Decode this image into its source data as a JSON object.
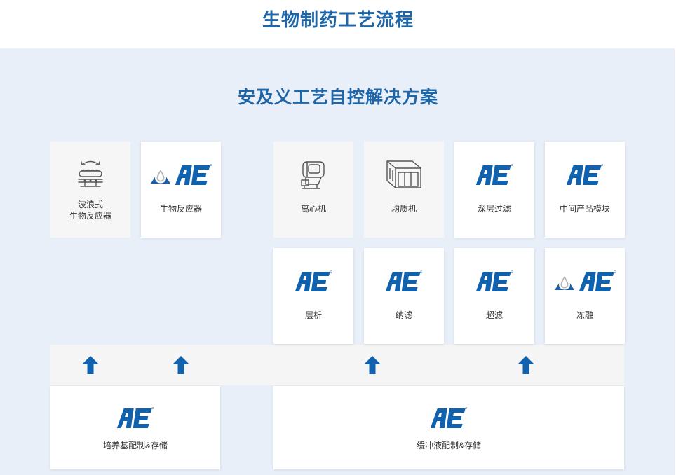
{
  "header": {
    "title": "生物制药工艺流程"
  },
  "panel": {
    "title": "安及义工艺自控解决方案"
  },
  "colors": {
    "brand_blue": "#1061ae",
    "title_blue": "#1f66a8",
    "drop_blue": "#1a5fa8"
  },
  "logo": {
    "text": "AE"
  },
  "cards": {
    "wave_bioreactor": {
      "label_line1": "波浪式",
      "label_line2": "生物反应器",
      "icon": "wave-bioreactor-icon"
    },
    "bioreactor": {
      "label": "生物反应器",
      "icon": "drop-ae-logo-icon"
    },
    "centrifuge": {
      "label": "离心机",
      "icon": "centrifuge-icon"
    },
    "homogenizer": {
      "label": "均质机",
      "icon": "homogenizer-icon"
    },
    "depth_filtration": {
      "label": "深层过滤",
      "icon": "ae-logo-icon"
    },
    "intermediate_module": {
      "label": "中间产品模块",
      "icon": "ae-logo-icon"
    },
    "chromatography": {
      "label": "层析",
      "icon": "ae-logo-icon"
    },
    "nanofiltration": {
      "label": "纳滤",
      "icon": "ae-logo-icon"
    },
    "ultrafiltration": {
      "label": "超滤",
      "icon": "ae-logo-icon"
    },
    "freeze_thaw": {
      "label": "冻融",
      "icon": "drop-ae-logo-icon"
    }
  },
  "bottom": {
    "media": {
      "label": "培养基配制&存储",
      "icon": "ae-logo-icon"
    },
    "buffer": {
      "label": "缓冲液配制&存储",
      "icon": "ae-logo-icon"
    }
  }
}
